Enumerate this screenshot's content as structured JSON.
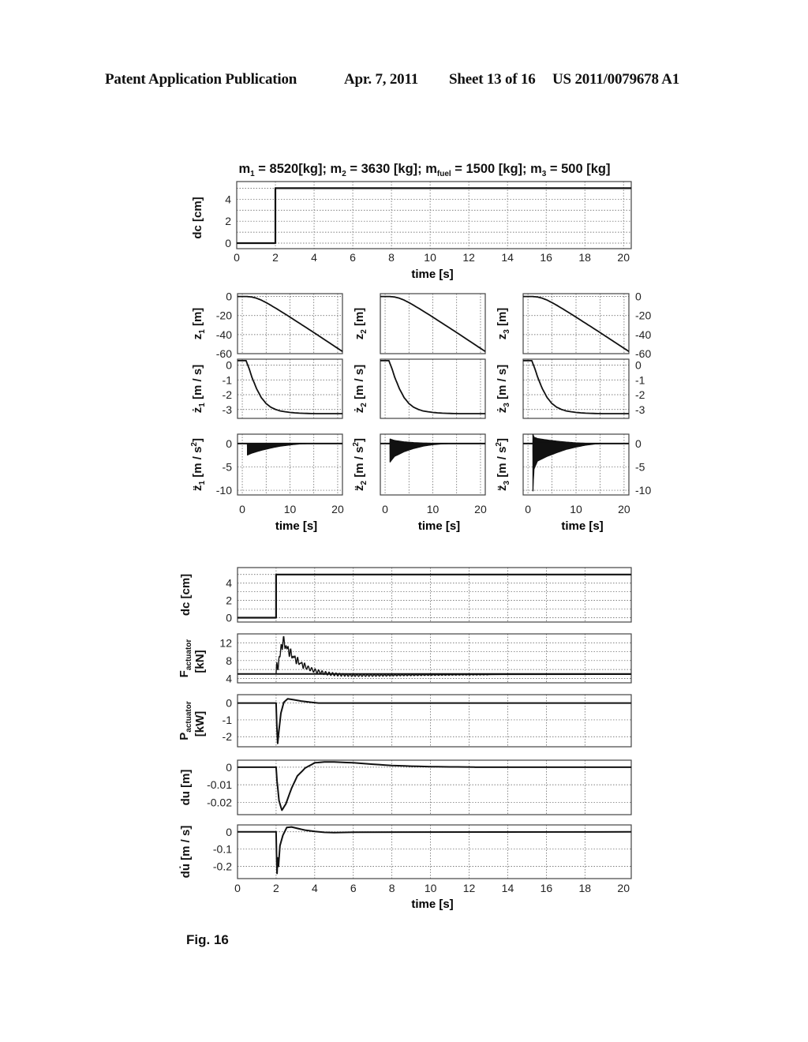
{
  "header": {
    "publication": "Patent Application Publication",
    "date": "Apr. 7, 2011",
    "sheet": "Sheet 13 of 16",
    "number": "US 2011/0079678 A1"
  },
  "figure_label": "Fig. 16",
  "chart_data": [
    {
      "id": "top-dc",
      "type": "line",
      "title": "m1 = 8520[kg];  m2 = 3630 [kg];  mfuel = 1500 [kg];  m3 = 500 [kg]",
      "title_parts": [
        {
          "t": "m"
        },
        {
          "sub": "1"
        },
        {
          "t": " = 8520[kg];  m"
        },
        {
          "sub": "2"
        },
        {
          "t": " = 3630 [kg];  m"
        },
        {
          "sub": "fuel"
        },
        {
          "t": " = 1500 [kg];  m"
        },
        {
          "sub": "3"
        },
        {
          "t": " = 500 [kg]"
        }
      ],
      "xlabel": "time [s]",
      "ylabel": "dc  [cm]",
      "xlim": [
        0,
        20.4
      ],
      "ylim": [
        -0.5,
        5.6
      ],
      "xticks": [
        0,
        2,
        4,
        6,
        8,
        10,
        12,
        14,
        16,
        18,
        20
      ],
      "yticks": [
        0,
        2,
        4
      ],
      "ygrid": [
        0,
        1,
        2,
        3,
        4,
        5
      ],
      "grid": true,
      "series": [
        {
          "name": "dc",
          "x": [
            0,
            2,
            2,
            20.4
          ],
          "y": [
            0,
            0,
            5,
            5
          ]
        }
      ]
    },
    {
      "id": "z1",
      "type": "line",
      "ylabel": "z1 [m]",
      "xlim": [
        -1,
        21
      ],
      "ylim": [
        -60,
        3
      ],
      "yticks": [
        0,
        -20,
        -40,
        -60
      ],
      "xticks": [
        0,
        10,
        20
      ],
      "xgrid": [
        0,
        5,
        10,
        15,
        20
      ],
      "grid": true,
      "series": [
        {
          "name": "z1",
          "x": [
            -1,
            1,
            2,
            3,
            4,
            5,
            6,
            8,
            10,
            12,
            14,
            16,
            18,
            20,
            21
          ],
          "y": [
            0,
            0,
            -0.5,
            -1.8,
            -3.8,
            -6.4,
            -9.2,
            -15.3,
            -21.6,
            -28.1,
            -34.6,
            -41.2,
            -47.8,
            -54.4,
            -57.7
          ]
        }
      ]
    },
    {
      "id": "z2",
      "type": "line",
      "ylabel": "z2 [m]",
      "xlim": [
        -1,
        21
      ],
      "ylim": [
        -60,
        3
      ],
      "yticks": [],
      "xticks": [
        0,
        10,
        20
      ],
      "xgrid": [
        0,
        5,
        10,
        15,
        20
      ],
      "grid": true,
      "series": [
        {
          "name": "z2",
          "x": [
            -1,
            1,
            2,
            3,
            4,
            5,
            6,
            8,
            10,
            12,
            14,
            16,
            18,
            20,
            21
          ],
          "y": [
            0,
            0,
            -0.5,
            -1.8,
            -3.8,
            -6.4,
            -9.2,
            -15.3,
            -21.6,
            -28.1,
            -34.6,
            -41.2,
            -47.8,
            -54.4,
            -57.7
          ]
        }
      ]
    },
    {
      "id": "z3",
      "type": "line",
      "ylabel": "z3 [m]",
      "xlim": [
        -1,
        21
      ],
      "ylim": [
        -60,
        3
      ],
      "yticks": [
        0,
        -20,
        -40,
        -60
      ],
      "ytick_side": "right",
      "xticks": [
        0,
        10,
        20
      ],
      "xgrid": [
        0,
        5,
        10,
        15,
        20
      ],
      "grid": true,
      "series": [
        {
          "name": "z3",
          "x": [
            -1,
            1,
            2,
            3,
            4,
            5,
            6,
            8,
            10,
            12,
            14,
            16,
            18,
            20,
            21
          ],
          "y": [
            0,
            0,
            -0.5,
            -1.8,
            -3.8,
            -6.4,
            -9.2,
            -15.3,
            -21.6,
            -28.1,
            -34.6,
            -41.2,
            -47.8,
            -54.4,
            -57.7
          ]
        }
      ]
    },
    {
      "id": "z1dot",
      "type": "line",
      "ylabel": "ż1 [m / s]",
      "xlim": [
        -1,
        21
      ],
      "ylim": [
        -3.6,
        0.4
      ],
      "yticks": [
        0,
        -1,
        -2,
        -3
      ],
      "xticks": [
        0,
        10,
        20
      ],
      "xgrid": [
        0,
        5,
        10,
        15,
        20
      ],
      "grid": true,
      "series": [
        {
          "name": "z1dot",
          "x": [
            -1,
            0.8,
            1.5,
            2,
            3,
            4,
            5,
            6,
            7,
            8,
            10,
            12,
            14,
            16,
            21
          ],
          "y": [
            0.3,
            0.3,
            -0.3,
            -0.8,
            -1.6,
            -2.2,
            -2.6,
            -2.85,
            -3.0,
            -3.1,
            -3.2,
            -3.25,
            -3.27,
            -3.28,
            -3.28
          ]
        }
      ]
    },
    {
      "id": "z2dot",
      "type": "line",
      "ylabel": "ż2 [m / s]",
      "xlim": [
        -1,
        21
      ],
      "ylim": [
        -3.6,
        0.4
      ],
      "yticks": [],
      "xticks": [
        0,
        10,
        20
      ],
      "xgrid": [
        0,
        5,
        10,
        15,
        20
      ],
      "grid": true,
      "series": [
        {
          "name": "z2dot",
          "x": [
            -1,
            0.8,
            1.5,
            2,
            3,
            4,
            5,
            6,
            7,
            8,
            10,
            12,
            14,
            16,
            21
          ],
          "y": [
            0.3,
            0.3,
            -0.3,
            -0.8,
            -1.6,
            -2.2,
            -2.6,
            -2.85,
            -3.0,
            -3.1,
            -3.2,
            -3.25,
            -3.27,
            -3.28,
            -3.28
          ]
        }
      ]
    },
    {
      "id": "z3dot",
      "type": "line",
      "ylabel": "ż3 [m / s]",
      "xlim": [
        -1,
        21
      ],
      "ylim": [
        -3.6,
        0.4
      ],
      "yticks": [
        0,
        -1,
        -2,
        -3
      ],
      "ytick_side": "right",
      "xticks": [
        0,
        10,
        20
      ],
      "xgrid": [
        0,
        5,
        10,
        15,
        20
      ],
      "grid": true,
      "series": [
        {
          "name": "z3dot",
          "x": [
            -1,
            0.8,
            1.5,
            2,
            3,
            4,
            5,
            6,
            7,
            8,
            10,
            12,
            14,
            16,
            21
          ],
          "y": [
            0.3,
            0.3,
            -0.3,
            -0.8,
            -1.6,
            -2.2,
            -2.6,
            -2.85,
            -3.0,
            -3.1,
            -3.2,
            -3.25,
            -3.27,
            -3.28,
            -3.28
          ]
        }
      ]
    },
    {
      "id": "z1ddot",
      "type": "area",
      "ylabel": "z̈1 [m / s²]",
      "xlabel": "time [s]",
      "xlim": [
        -1,
        21
      ],
      "ylim": [
        -11,
        2
      ],
      "yticks": [
        0,
        -5,
        -10
      ],
      "xticks": [
        0,
        10,
        20
      ],
      "xgrid": [
        0,
        5,
        10,
        15,
        20
      ],
      "grid": true,
      "baseline": 0,
      "envelope": {
        "x": [
          1,
          1.1,
          2,
          4,
          6,
          8,
          10,
          12,
          14,
          21
        ],
        "upper": [
          0,
          0,
          0,
          0,
          0,
          0,
          0,
          0,
          0,
          0
        ],
        "lower": [
          0,
          -2.5,
          -2.1,
          -1.5,
          -1.0,
          -0.6,
          -0.35,
          -0.15,
          -0.05,
          0
        ]
      }
    },
    {
      "id": "z2ddot",
      "type": "area",
      "ylabel": "z̈2 [m / s²]",
      "xlabel": "time [s]",
      "xlim": [
        -1,
        21
      ],
      "ylim": [
        -11,
        2
      ],
      "yticks": [],
      "xticks": [
        0,
        10,
        20
      ],
      "xgrid": [
        0,
        5,
        10,
        15,
        20
      ],
      "grid": true,
      "baseline": 0,
      "envelope": {
        "x": [
          1,
          1.05,
          2,
          4,
          6,
          8,
          10,
          12,
          14,
          21
        ],
        "upper": [
          0,
          1.0,
          0.7,
          0.4,
          0.25,
          0.15,
          0.08,
          0.03,
          0,
          0
        ],
        "lower": [
          0,
          -4.0,
          -2.8,
          -1.8,
          -1.1,
          -0.6,
          -0.3,
          -0.12,
          -0.03,
          0
        ]
      }
    },
    {
      "id": "z3ddot",
      "type": "area",
      "ylabel": "z̈3 [m / s²]",
      "xlabel": "time [s]",
      "xlim": [
        -1,
        21
      ],
      "ylim": [
        -11,
        2
      ],
      "yticks": [
        0,
        -5,
        -10
      ],
      "ytick_side": "right",
      "xticks": [
        0,
        10,
        20
      ],
      "xgrid": [
        0,
        5,
        10,
        15,
        20
      ],
      "grid": true,
      "baseline": 0,
      "envelope": {
        "x": [
          1,
          1.05,
          1.3,
          2,
          4,
          6,
          8,
          10,
          12,
          14,
          16,
          21
        ],
        "upper": [
          0,
          2.0,
          1.4,
          1.1,
          0.8,
          0.55,
          0.35,
          0.2,
          0.1,
          0.03,
          0,
          0
        ],
        "lower": [
          0,
          -10.2,
          -5.5,
          -3.8,
          -2.8,
          -2.0,
          -1.3,
          -0.8,
          -0.4,
          -0.15,
          -0.03,
          0
        ]
      }
    },
    {
      "id": "low-dc",
      "type": "line",
      "ylabel": "dc  [cm]",
      "xlim": [
        0,
        20.4
      ],
      "ylim": [
        -0.5,
        5.8
      ],
      "yticks": [
        0,
        2,
        4
      ],
      "ygrid": [
        0,
        1,
        2,
        3,
        4,
        5
      ],
      "xgrid": [
        2,
        4,
        6,
        8,
        10,
        12,
        14,
        16,
        18
      ],
      "grid": true,
      "series": [
        {
          "name": "dc",
          "x": [
            0,
            2,
            2,
            20.4
          ],
          "y": [
            0,
            0,
            5,
            5
          ]
        }
      ]
    },
    {
      "id": "F-actuator",
      "type": "line",
      "ylabel": "F_actuator [kN]",
      "xlim": [
        0,
        20.4
      ],
      "ylim": [
        3,
        14
      ],
      "yticks": [
        12,
        8,
        4
      ],
      "ygrid": [
        4,
        6,
        8,
        10,
        12
      ],
      "xgrid": [
        2,
        4,
        6,
        8,
        10,
        12,
        14,
        16,
        18
      ],
      "grid": true,
      "baseline_series": {
        "x": [
          0,
          20.4
        ],
        "y": [
          5,
          5
        ]
      },
      "damped_oscillation": {
        "start": 2.0,
        "pre": 5.0,
        "final": 4.9,
        "peak": 12.5,
        "peak_time": 2.35,
        "decay": 0.95,
        "undershoot": 4.0,
        "osc_period": 0.18,
        "osc_amp": 0.7,
        "osc_decay": 0.25,
        "end": 13
      }
    },
    {
      "id": "P-actuator",
      "type": "line",
      "ylabel": "P_actuator [kW]",
      "xlim": [
        0,
        20.4
      ],
      "ylim": [
        -2.6,
        0.5
      ],
      "yticks": [
        0,
        -1,
        -2
      ],
      "ygrid": [
        0,
        -1,
        -2
      ],
      "xgrid": [
        2,
        4,
        6,
        8,
        10,
        12,
        14,
        16,
        18
      ],
      "grid": true,
      "series": [
        {
          "name": "P",
          "x": [
            0,
            2,
            2.03,
            2.08,
            2.15,
            2.25,
            2.4,
            2.6,
            2.9,
            3.3,
            3.8,
            4.2,
            20.4
          ],
          "y": [
            0,
            0,
            -1.2,
            -2.4,
            -1.6,
            -0.6,
            0.05,
            0.25,
            0.2,
            0.12,
            0.05,
            0,
            0
          ]
        }
      ]
    },
    {
      "id": "du",
      "type": "line",
      "ylabel": "du  [m]",
      "xlim": [
        0,
        20.4
      ],
      "ylim": [
        -0.027,
        0.004
      ],
      "yticks": [
        0,
        -0.01,
        -0.02
      ],
      "ygrid": [
        0,
        -0.01,
        -0.02
      ],
      "xgrid": [
        2,
        4,
        6,
        8,
        10,
        12,
        14,
        16,
        18
      ],
      "grid": true,
      "series": [
        {
          "name": "du",
          "x": [
            0,
            2,
            2.05,
            2.15,
            2.3,
            2.5,
            2.8,
            3.1,
            3.5,
            4,
            4.5,
            5,
            6,
            7,
            8,
            9,
            10,
            11,
            12.2,
            12.3,
            20.4
          ],
          "y": [
            0,
            0,
            -0.008,
            -0.019,
            -0.0245,
            -0.021,
            -0.012,
            -0.005,
            -0.0005,
            0.0025,
            0.003,
            0.003,
            0.0025,
            0.0017,
            0.001,
            0.0006,
            0.0003,
            0.0002,
            0.0001,
            0,
            0
          ]
        }
      ]
    },
    {
      "id": "du-dot",
      "type": "line",
      "ylabel": "du̇ [m / s]",
      "xlabel": "time [s]",
      "xlim": [
        0,
        20.4
      ],
      "ylim": [
        -0.27,
        0.04
      ],
      "yticks": [
        0,
        -0.1,
        -0.2
      ],
      "ygrid": [
        0,
        -0.1,
        -0.2
      ],
      "xticks": [
        0,
        2,
        4,
        6,
        8,
        10,
        12,
        14,
        16,
        18,
        20
      ],
      "xgrid": [
        2,
        4,
        6,
        8,
        10,
        12,
        14,
        16,
        18
      ],
      "grid": true,
      "series": [
        {
          "name": "dudot",
          "x": [
            0,
            2,
            2.02,
            2.05,
            2.08,
            2.12,
            2.2,
            2.35,
            2.55,
            2.8,
            3.1,
            3.5,
            4,
            4.5,
            5,
            6,
            20.4
          ],
          "y": [
            0,
            0,
            -0.12,
            -0.24,
            -0.15,
            -0.2,
            -0.08,
            -0.02,
            0.025,
            0.028,
            0.02,
            0.01,
            0.002,
            -0.003,
            -0.004,
            -0.002,
            0
          ]
        }
      ]
    }
  ]
}
